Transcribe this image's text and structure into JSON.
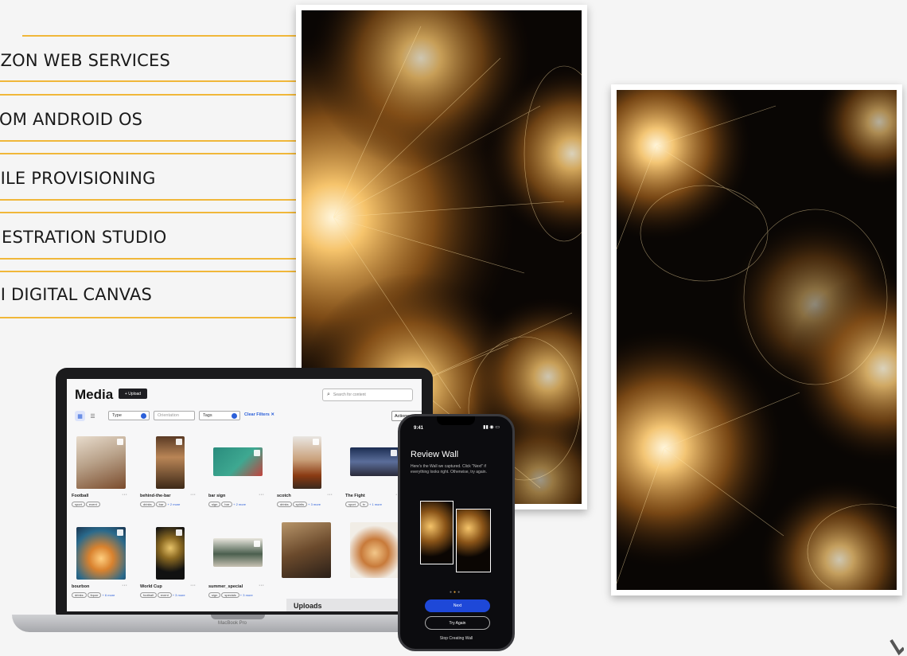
{
  "menu": {
    "items": [
      {
        "label": "AZON WEB SERVICES"
      },
      {
        "label": "TOM ANDROID OS"
      },
      {
        "label": "BILE PROVISIONING"
      },
      {
        "label": "HESTRATION STUDIO"
      },
      {
        "label": "RI DIGITAL CANVAS"
      }
    ]
  },
  "colors": {
    "accent_line": "#f0b73a",
    "art_glow": "#f3c574",
    "primary_button": "#1e48d8"
  },
  "laptop": {
    "brand": "MacBook Pro",
    "app": {
      "title": "Media",
      "upload_label": "+ Upload",
      "search_placeholder": "Search for content",
      "filters": {
        "type_label": "Type",
        "orientation_label": "Orientation",
        "tags_label": "Tags",
        "clear_label": "Clear Filters",
        "actions_label": "Actions"
      },
      "cards": [
        {
          "name": "Football",
          "tags": [
            "sport",
            "event"
          ],
          "more": ""
        },
        {
          "name": "behind-the-bar",
          "tags": [
            "drinks",
            "bar"
          ],
          "more": "+ 2 more"
        },
        {
          "name": "bar sign",
          "tags": [
            "sign",
            "bar"
          ],
          "more": "+ 2 more"
        },
        {
          "name": "scotch",
          "tags": [
            "drinks",
            "spirits"
          ],
          "more": "+ 3 more"
        },
        {
          "name": "The Fight",
          "tags": [
            "sport",
            "tv"
          ],
          "more": "+ 1 more"
        },
        {
          "name": "bourbon",
          "tags": [
            "drinks",
            "liquor"
          ],
          "more": "+ 6 more"
        },
        {
          "name": "World Cup",
          "tags": [
            "football",
            "event"
          ],
          "more": "+ 3 more"
        },
        {
          "name": "summer_special",
          "tags": [
            "sign",
            "specials"
          ],
          "more": "+ 3 more"
        },
        {
          "name": "",
          "tags": [],
          "more": ""
        },
        {
          "name": "",
          "tags": [],
          "more": ""
        }
      ],
      "uploads_label": "Uploads"
    }
  },
  "phone": {
    "time": "9:41",
    "title": "Review Wall",
    "description": "Here's the Wall we captured. Click \"Next\" if everything looks right. Otherwise, try again.",
    "next_label": "Next",
    "try_again_label": "Try Again",
    "stop_label": "Stop Creating Wall"
  }
}
